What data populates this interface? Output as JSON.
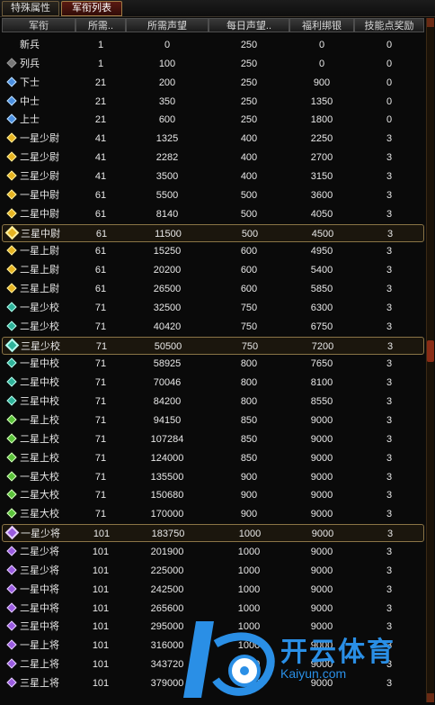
{
  "tabs": [
    {
      "label": "特殊属性",
      "active": false
    },
    {
      "label": "军衔列表",
      "active": true
    }
  ],
  "columns": [
    "军衔",
    "所需..",
    "所需声望",
    "每日声望..",
    "福利绑银",
    "技能点奖励"
  ],
  "rows": [
    {
      "rank": "新兵",
      "icon": "none",
      "c1": "1",
      "c2": "0",
      "c3": "250",
      "c4": "0",
      "c5": "0",
      "hl": false
    },
    {
      "rank": "列兵",
      "icon": "gray",
      "c1": "1",
      "c2": "100",
      "c3": "250",
      "c4": "0",
      "c5": "0",
      "hl": false
    },
    {
      "rank": "下士",
      "icon": "blue",
      "c1": "21",
      "c2": "200",
      "c3": "250",
      "c4": "900",
      "c5": "0",
      "hl": false
    },
    {
      "rank": "中士",
      "icon": "blue",
      "c1": "21",
      "c2": "350",
      "c3": "250",
      "c4": "1350",
      "c5": "0",
      "hl": false
    },
    {
      "rank": "上士",
      "icon": "blue",
      "c1": "21",
      "c2": "600",
      "c3": "250",
      "c4": "1800",
      "c5": "0",
      "hl": false
    },
    {
      "rank": "一星少尉",
      "icon": "yellow",
      "c1": "41",
      "c2": "1325",
      "c3": "400",
      "c4": "2250",
      "c5": "3",
      "hl": false
    },
    {
      "rank": "二星少尉",
      "icon": "yellow",
      "c1": "41",
      "c2": "2282",
      "c3": "400",
      "c4": "2700",
      "c5": "3",
      "hl": false
    },
    {
      "rank": "三星少尉",
      "icon": "yellow",
      "c1": "41",
      "c2": "3500",
      "c3": "400",
      "c4": "3150",
      "c5": "3",
      "hl": false
    },
    {
      "rank": "一星中尉",
      "icon": "yellow",
      "c1": "61",
      "c2": "5500",
      "c3": "500",
      "c4": "3600",
      "c5": "3",
      "hl": false
    },
    {
      "rank": "二星中尉",
      "icon": "yellow",
      "c1": "61",
      "c2": "8140",
      "c3": "500",
      "c4": "4050",
      "c5": "3",
      "hl": false
    },
    {
      "rank": "三星中尉",
      "icon": "yellow",
      "c1": "61",
      "c2": "11500",
      "c3": "500",
      "c4": "4500",
      "c5": "3",
      "hl": true
    },
    {
      "rank": "一星上尉",
      "icon": "yellow",
      "c1": "61",
      "c2": "15250",
      "c3": "600",
      "c4": "4950",
      "c5": "3",
      "hl": false
    },
    {
      "rank": "二星上尉",
      "icon": "yellow",
      "c1": "61",
      "c2": "20200",
      "c3": "600",
      "c4": "5400",
      "c5": "3",
      "hl": false
    },
    {
      "rank": "三星上尉",
      "icon": "yellow",
      "c1": "61",
      "c2": "26500",
      "c3": "600",
      "c4": "5850",
      "c5": "3",
      "hl": false
    },
    {
      "rank": "一星少校",
      "icon": "teal",
      "c1": "71",
      "c2": "32500",
      "c3": "750",
      "c4": "6300",
      "c5": "3",
      "hl": false
    },
    {
      "rank": "二星少校",
      "icon": "teal",
      "c1": "71",
      "c2": "40420",
      "c3": "750",
      "c4": "6750",
      "c5": "3",
      "hl": false
    },
    {
      "rank": "三星少校",
      "icon": "teal",
      "c1": "71",
      "c2": "50500",
      "c3": "750",
      "c4": "7200",
      "c5": "3",
      "hl": true
    },
    {
      "rank": "一星中校",
      "icon": "teal",
      "c1": "71",
      "c2": "58925",
      "c3": "800",
      "c4": "7650",
      "c5": "3",
      "hl": false
    },
    {
      "rank": "二星中校",
      "icon": "teal",
      "c1": "71",
      "c2": "70046",
      "c3": "800",
      "c4": "8100",
      "c5": "3",
      "hl": false
    },
    {
      "rank": "三星中校",
      "icon": "teal",
      "c1": "71",
      "c2": "84200",
      "c3": "800",
      "c4": "8550",
      "c5": "3",
      "hl": false
    },
    {
      "rank": "一星上校",
      "icon": "green",
      "c1": "71",
      "c2": "94150",
      "c3": "850",
      "c4": "9000",
      "c5": "3",
      "hl": false
    },
    {
      "rank": "二星上校",
      "icon": "green",
      "c1": "71",
      "c2": "107284",
      "c3": "850",
      "c4": "9000",
      "c5": "3",
      "hl": false
    },
    {
      "rank": "三星上校",
      "icon": "green",
      "c1": "71",
      "c2": "124000",
      "c3": "850",
      "c4": "9000",
      "c5": "3",
      "hl": false
    },
    {
      "rank": "一星大校",
      "icon": "green",
      "c1": "71",
      "c2": "135500",
      "c3": "900",
      "c4": "9000",
      "c5": "3",
      "hl": false
    },
    {
      "rank": "二星大校",
      "icon": "green",
      "c1": "71",
      "c2": "150680",
      "c3": "900",
      "c4": "9000",
      "c5": "3",
      "hl": false
    },
    {
      "rank": "三星大校",
      "icon": "green",
      "c1": "71",
      "c2": "170000",
      "c3": "900",
      "c4": "9000",
      "c5": "3",
      "hl": false
    },
    {
      "rank": "一星少将",
      "icon": "purple",
      "c1": "101",
      "c2": "183750",
      "c3": "1000",
      "c4": "9000",
      "c5": "3",
      "hl": true
    },
    {
      "rank": "二星少将",
      "icon": "purple",
      "c1": "101",
      "c2": "201900",
      "c3": "1000",
      "c4": "9000",
      "c5": "3",
      "hl": false
    },
    {
      "rank": "三星少将",
      "icon": "purple",
      "c1": "101",
      "c2": "225000",
      "c3": "1000",
      "c4": "9000",
      "c5": "3",
      "hl": false
    },
    {
      "rank": "一星中将",
      "icon": "purple",
      "c1": "101",
      "c2": "242500",
      "c3": "1000",
      "c4": "9000",
      "c5": "3",
      "hl": false
    },
    {
      "rank": "二星中将",
      "icon": "purple",
      "c1": "101",
      "c2": "265600",
      "c3": "1000",
      "c4": "9000",
      "c5": "3",
      "hl": false
    },
    {
      "rank": "三星中将",
      "icon": "purple",
      "c1": "101",
      "c2": "295000",
      "c3": "1000",
      "c4": "9000",
      "c5": "3",
      "hl": false
    },
    {
      "rank": "一星上将",
      "icon": "purple",
      "c1": "101",
      "c2": "316000",
      "c3": "1000",
      "c4": "9000",
      "c5": "3",
      "hl": false
    },
    {
      "rank": "二星上将",
      "icon": "purple",
      "c1": "101",
      "c2": "343720",
      "c3": "1000",
      "c4": "9000",
      "c5": "3",
      "hl": false
    },
    {
      "rank": "三星上将",
      "icon": "purple",
      "c1": "101",
      "c2": "379000",
      "c3": "1000",
      "c4": "9000",
      "c5": "3",
      "hl": false
    }
  ],
  "watermark": {
    "text": "开云体育",
    "url": "Kaiyun.com",
    "color": "#2a8fe6"
  }
}
